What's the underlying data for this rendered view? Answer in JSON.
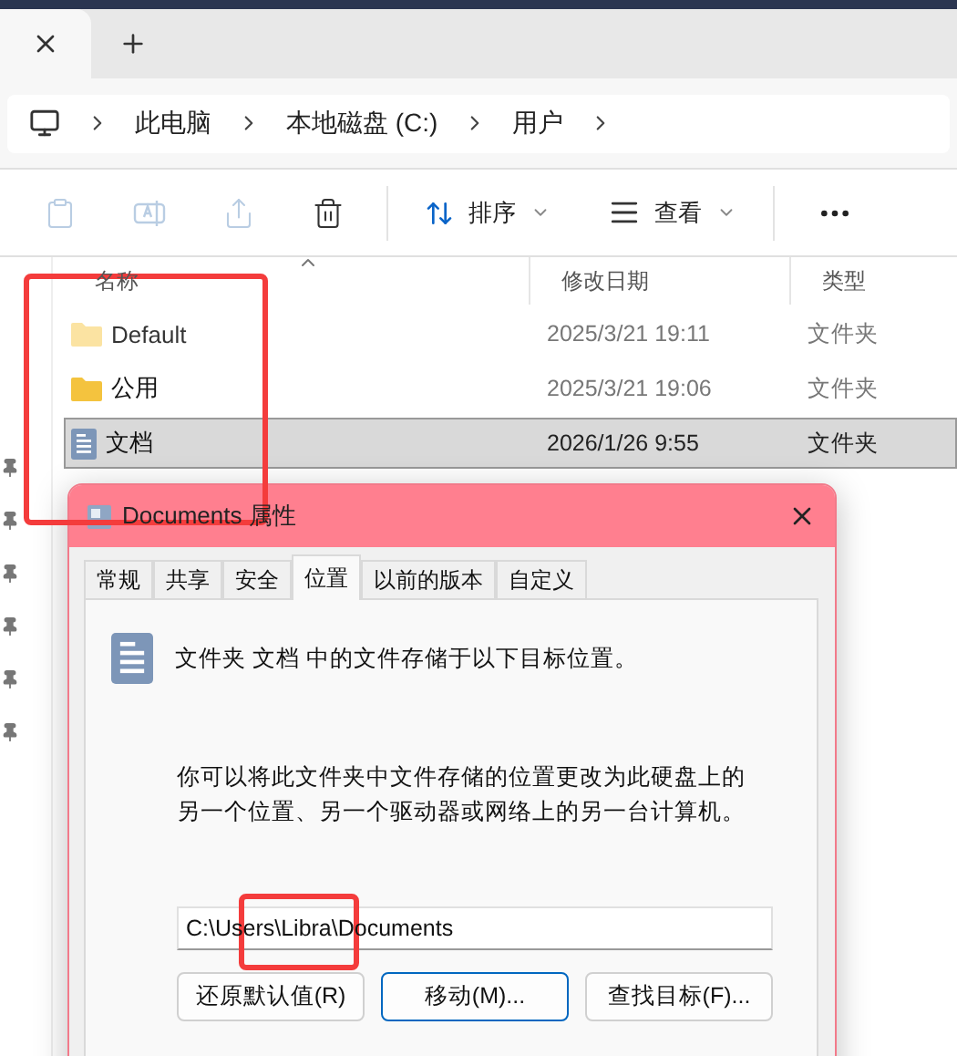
{
  "address_bar": {
    "crumbs": [
      "此电脑",
      "本地磁盘 (C:)",
      "用户"
    ]
  },
  "toolbar": {
    "actions": [
      {
        "disabled": true
      },
      {
        "disabled": true
      },
      {
        "disabled": true
      },
      {
        "disabled": false
      }
    ],
    "sort": {
      "label": "排序"
    },
    "view": {
      "label": "查看"
    }
  },
  "file_list": {
    "columns": [
      {
        "label": "名称",
        "sorted": true
      },
      {
        "label": "修改日期",
        "sorted": false
      },
      {
        "label": "类型",
        "sorted": false
      }
    ],
    "rows": [
      {
        "kind": "folder",
        "hidden": true,
        "name": "Default",
        "date": "2025/3/21 19:11",
        "type": "文件夹",
        "selected": false
      },
      {
        "kind": "folder",
        "hidden": false,
        "name": "公用",
        "date": "2025/3/21 19:06",
        "type": "文件夹",
        "selected": false
      },
      {
        "kind": "documents",
        "hidden": false,
        "name": "文档",
        "date": "2026/1/26 9:55",
        "type": "文件夹",
        "selected": true
      }
    ]
  },
  "dialog": {
    "title": "Documents 属性",
    "tabs": [
      {
        "label": "常规",
        "selected": false
      },
      {
        "label": "共享",
        "selected": false
      },
      {
        "label": "安全",
        "selected": false
      },
      {
        "label": "位置",
        "selected": true
      },
      {
        "label": "以前的版本",
        "selected": false
      },
      {
        "label": "自定义",
        "selected": false
      }
    ],
    "info": "文件夹 文档 中的文件存储于以下目标位置。",
    "description": "你可以将此文件夹中文件存储的位置更改为此硬盘上的另一个位置、另一个驱动器或网络上的另一台计算机。",
    "path": "C:\\Users\\Libra\\Documents",
    "buttons": [
      {
        "label": "还原默认值(R)",
        "default": false
      },
      {
        "label": "移动(M)...",
        "default": true
      },
      {
        "label": "查找目标(F)...",
        "default": false
      }
    ]
  }
}
